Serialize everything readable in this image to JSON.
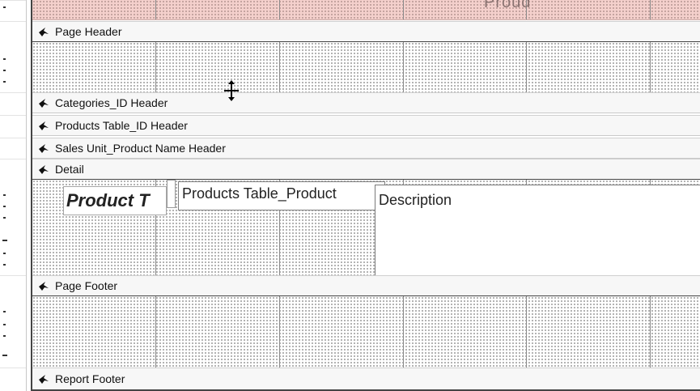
{
  "report_header": {
    "faint_title": "Proud"
  },
  "sections": [
    {
      "name": "page_header",
      "label": "Page Header"
    },
    {
      "name": "categories_header",
      "label": "Categories_ID Header"
    },
    {
      "name": "products_table_header",
      "label": "Products Table_ID Header"
    },
    {
      "name": "sales_unit_header",
      "label": "Sales Unit_Product Name Header"
    },
    {
      "name": "detail",
      "label": "Detail"
    },
    {
      "name": "page_footer",
      "label": "Page Footer"
    },
    {
      "name": "report_footer",
      "label": "Report Footer"
    }
  ],
  "detail_controls": {
    "title_label": "Product T",
    "field_textbox": "Products Table_Product",
    "description_textbox": "Description"
  },
  "icons": {
    "band_arrow": "band-collapse-arrow-icon",
    "cursor": "move-cursor-icon"
  }
}
